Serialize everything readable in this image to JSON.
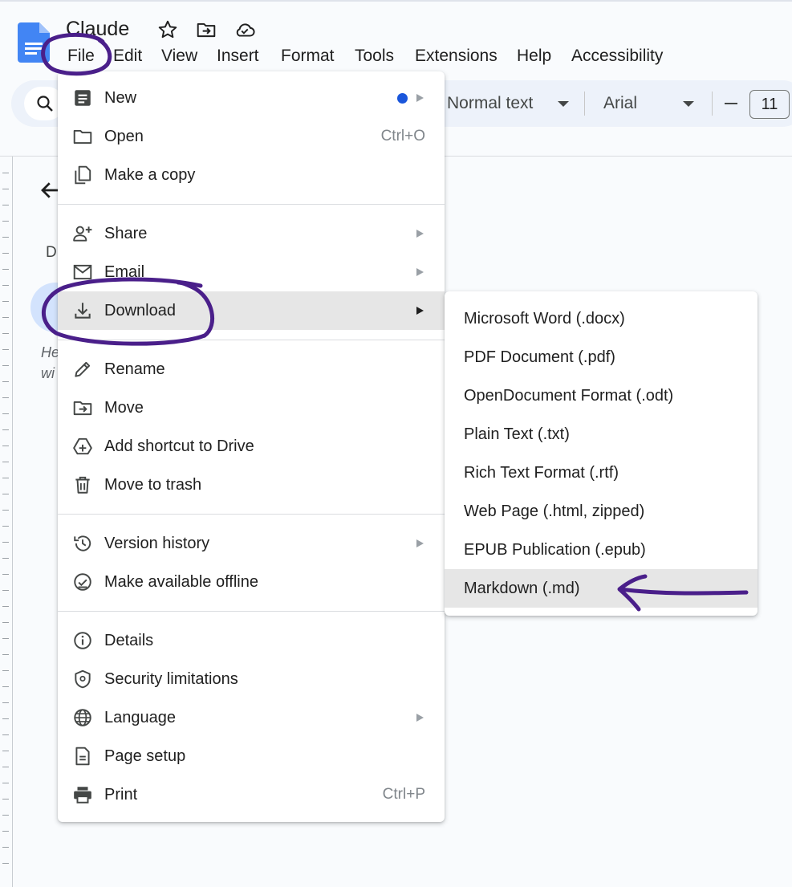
{
  "app": {
    "title": "Claude",
    "accent_color": "#1a73e8",
    "annotation_color": "#4a1f8a"
  },
  "header": {
    "icons": [
      "star-icon",
      "move-folder-icon",
      "cloud-saved-icon"
    ]
  },
  "menubar": {
    "items": [
      "File",
      "Edit",
      "View",
      "Insert",
      "Format",
      "Tools",
      "Extensions",
      "Help",
      "Accessibility"
    ]
  },
  "toolbar": {
    "paragraph_style": "Normal text",
    "font": "Arial",
    "font_size": "11"
  },
  "document": {
    "outline_letter": "D",
    "ghost_line_1": "He",
    "ghost_line_2": "wi"
  },
  "file_menu": {
    "items": [
      {
        "label": "New",
        "icon": "new-document-icon"
      },
      {
        "label": "Open",
        "icon": "folder-icon",
        "shortcut": "Ctrl+O"
      },
      {
        "label": "Make a copy",
        "icon": "copy-icon"
      },
      {
        "label": "Share",
        "icon": "person-add-icon"
      },
      {
        "label": "Email",
        "icon": "mail-icon"
      },
      {
        "label": "Download",
        "icon": "download-icon"
      },
      {
        "label": "Rename",
        "icon": "pencil-icon"
      },
      {
        "label": "Move",
        "icon": "move-folder-icon"
      },
      {
        "label": "Add shortcut to Drive",
        "icon": "drive-shortcut-icon"
      },
      {
        "label": "Move to trash",
        "icon": "trash-icon"
      },
      {
        "label": "Version history",
        "icon": "history-icon"
      },
      {
        "label": "Make available offline",
        "icon": "offline-check-icon"
      },
      {
        "label": "Details",
        "icon": "info-icon"
      },
      {
        "label": "Security limitations",
        "icon": "shield-icon"
      },
      {
        "label": "Language",
        "icon": "globe-icon"
      },
      {
        "label": "Page setup",
        "icon": "page-icon"
      },
      {
        "label": "Print",
        "icon": "printer-icon",
        "shortcut": "Ctrl+P"
      }
    ]
  },
  "download_menu": {
    "items": [
      "Microsoft Word (.docx)",
      "PDF Document (.pdf)",
      "OpenDocument Format (.odt)",
      "Plain Text (.txt)",
      "Rich Text Format (.rtf)",
      "Web Page (.html, zipped)",
      "EPUB Publication (.epub)",
      "Markdown (.md)"
    ]
  }
}
